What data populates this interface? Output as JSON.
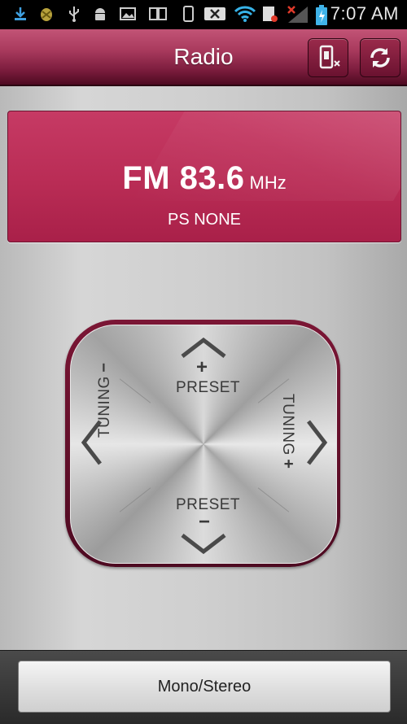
{
  "status_bar": {
    "time": "7:07 AM",
    "icons": [
      "download-icon",
      "android-bug-icon",
      "usb-icon",
      "android-icon",
      "image-icon",
      "screen-share-icon",
      "phone-icon",
      "missed-call-icon",
      "wifi-icon",
      "sim-icon",
      "no-signal-icon",
      "battery-charging-icon"
    ]
  },
  "header": {
    "title": "Radio",
    "buttons": [
      "speaker-output-icon",
      "refresh-icon"
    ]
  },
  "display": {
    "band_frequency": "FM 83.6",
    "unit": "MHz",
    "ps": "PS NONE"
  },
  "pad": {
    "preset_up_label": "PRESET",
    "preset_up_sign": "+",
    "preset_down_label": "PRESET",
    "preset_down_sign": "−",
    "tuning_down_label": "TUNING",
    "tuning_down_sign": "−",
    "tuning_up_label": "TUNING",
    "tuning_up_sign": "+"
  },
  "bottom": {
    "mono_stereo_label": "Mono/Stereo"
  },
  "colors": {
    "accent": "#b92c55",
    "title_bar": "#8a2447"
  }
}
